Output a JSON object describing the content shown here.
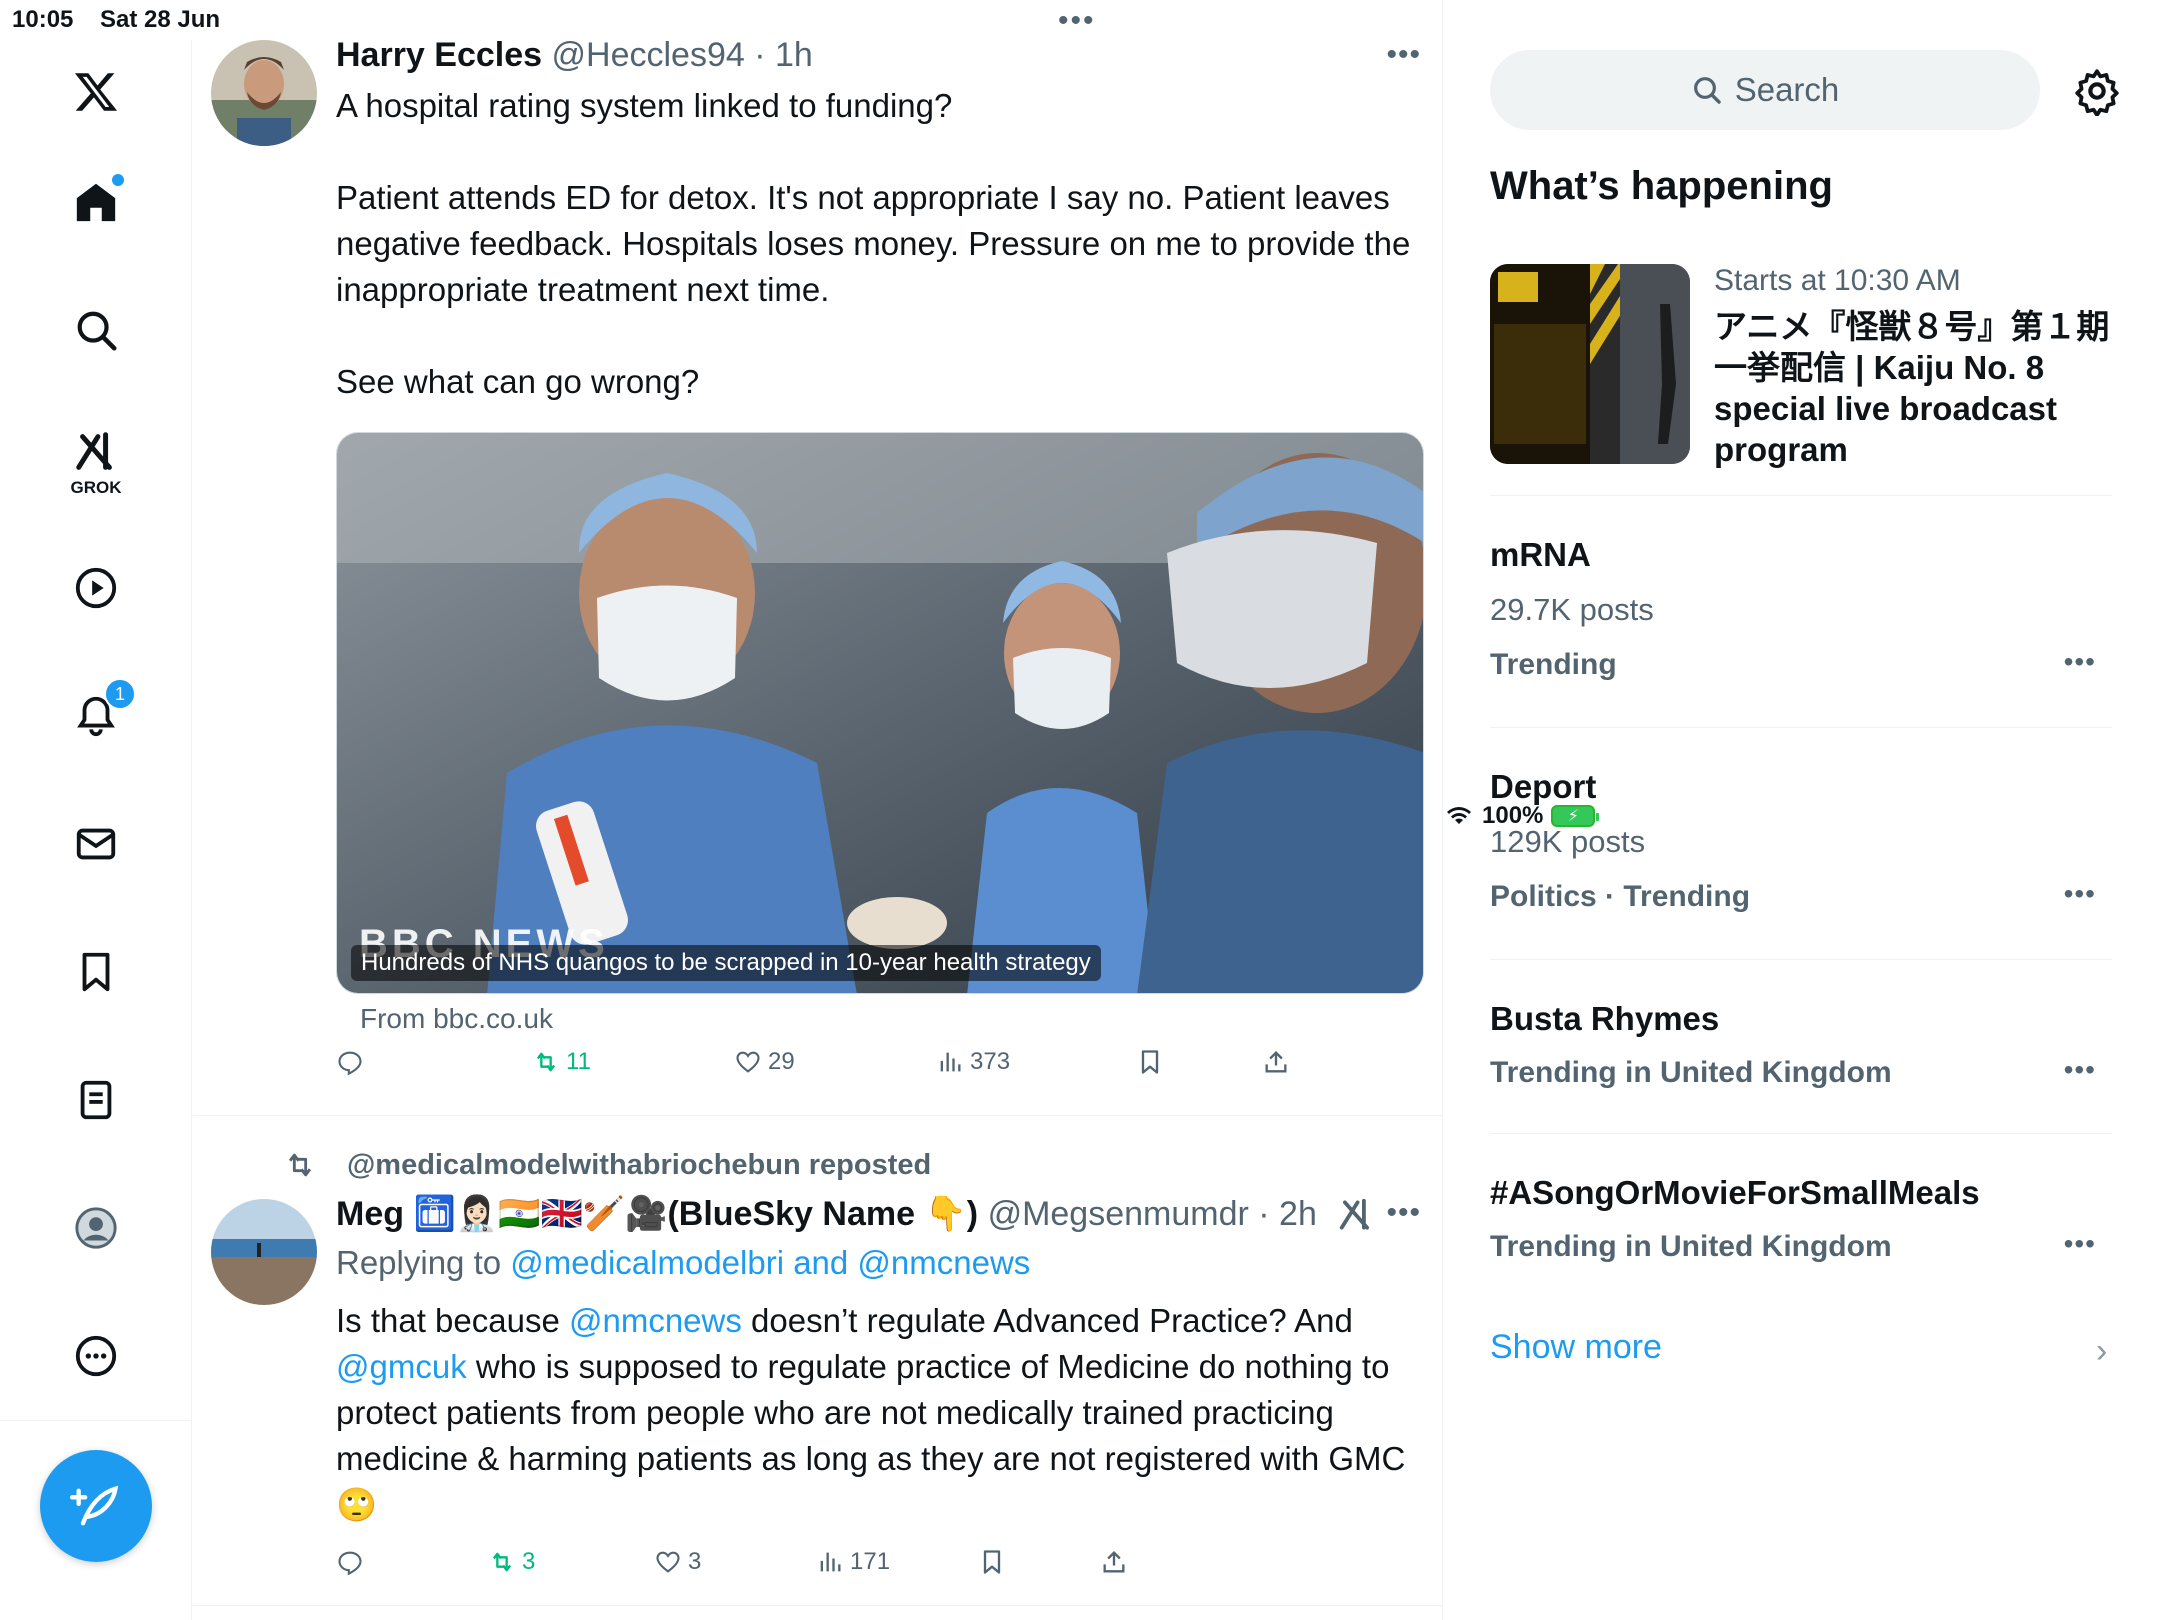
{
  "status_bar": {
    "time": "10:05",
    "date": "Sat 28 Jun",
    "battery": "100%"
  },
  "nav": {
    "grok_label": "GROK",
    "notifications_count": "1"
  },
  "posts": [
    {
      "name": "Harry Eccles",
      "handle": "@Heccles94",
      "time": "· 1h",
      "paragraphs": [
        "A hospital rating system linked to funding?",
        "Patient attends ED for detox. It's not appropriate I say no. Patient leaves negative feedback. Hospitals loses money. Pressure on me to provide the inappropriate treatment next time.",
        "See what can go wrong?"
      ],
      "media": {
        "brand": "BBC NEWS",
        "caption": "Hundreds of NHS quangos to be scrapped in 10-year health strategy",
        "source": "From bbc.co.uk"
      },
      "stats": {
        "replies": "",
        "reposts": "11",
        "likes": "29",
        "views": "373"
      }
    },
    {
      "reposted_by": "@medicalmodelwithabriochebun reposted",
      "name": "Meg 🛅👩🏻‍⚕️🇮🇳🇬🇧🏏🎥(BlueSky Name 👇)",
      "handle": "@Megsenmumdr",
      "time": "· 2h",
      "replying_prefix": "Replying to ",
      "replying_to": "@medicalmodelbri and @nmcnews",
      "text_1": "Is that because ",
      "mention_1": "@nmcnews",
      "text_2": " doesn’t regulate Advanced Practice? And ",
      "mention_2": "@gmcuk",
      "text_3": " who is supposed to regulate practice of Medicine do nothing to protect patients from people who are not medically trained practicing medicine & harming patients as long as they are not registered with GMC 🙄",
      "stats": {
        "replies": "",
        "reposts": "3",
        "likes": "3",
        "views": "171"
      }
    }
  ],
  "sidebar": {
    "search_placeholder": "Search",
    "section_title": "What’s happening",
    "event": {
      "meta": "Starts at 10:30 AM",
      "title": "アニメ『怪獣８号』第１期一挙配信 | Kaiju No. 8 special live broadcast program"
    },
    "trends": [
      {
        "name": "mRNA",
        "posts": "29.7K posts",
        "context": "Trending"
      },
      {
        "name": "Deport",
        "posts": "129K posts",
        "context": "Politics · Trending"
      },
      {
        "name": "Busta Rhymes",
        "posts": "",
        "context": "Trending in United Kingdom"
      },
      {
        "name": "#ASongOrMovieForSmallMeals",
        "posts": "",
        "context": "Trending in United Kingdom"
      }
    ],
    "show_more": "Show more"
  },
  "colors": {
    "accent": "#1d9bf0",
    "repost_green": "#00ba7c",
    "muted": "#536471"
  }
}
